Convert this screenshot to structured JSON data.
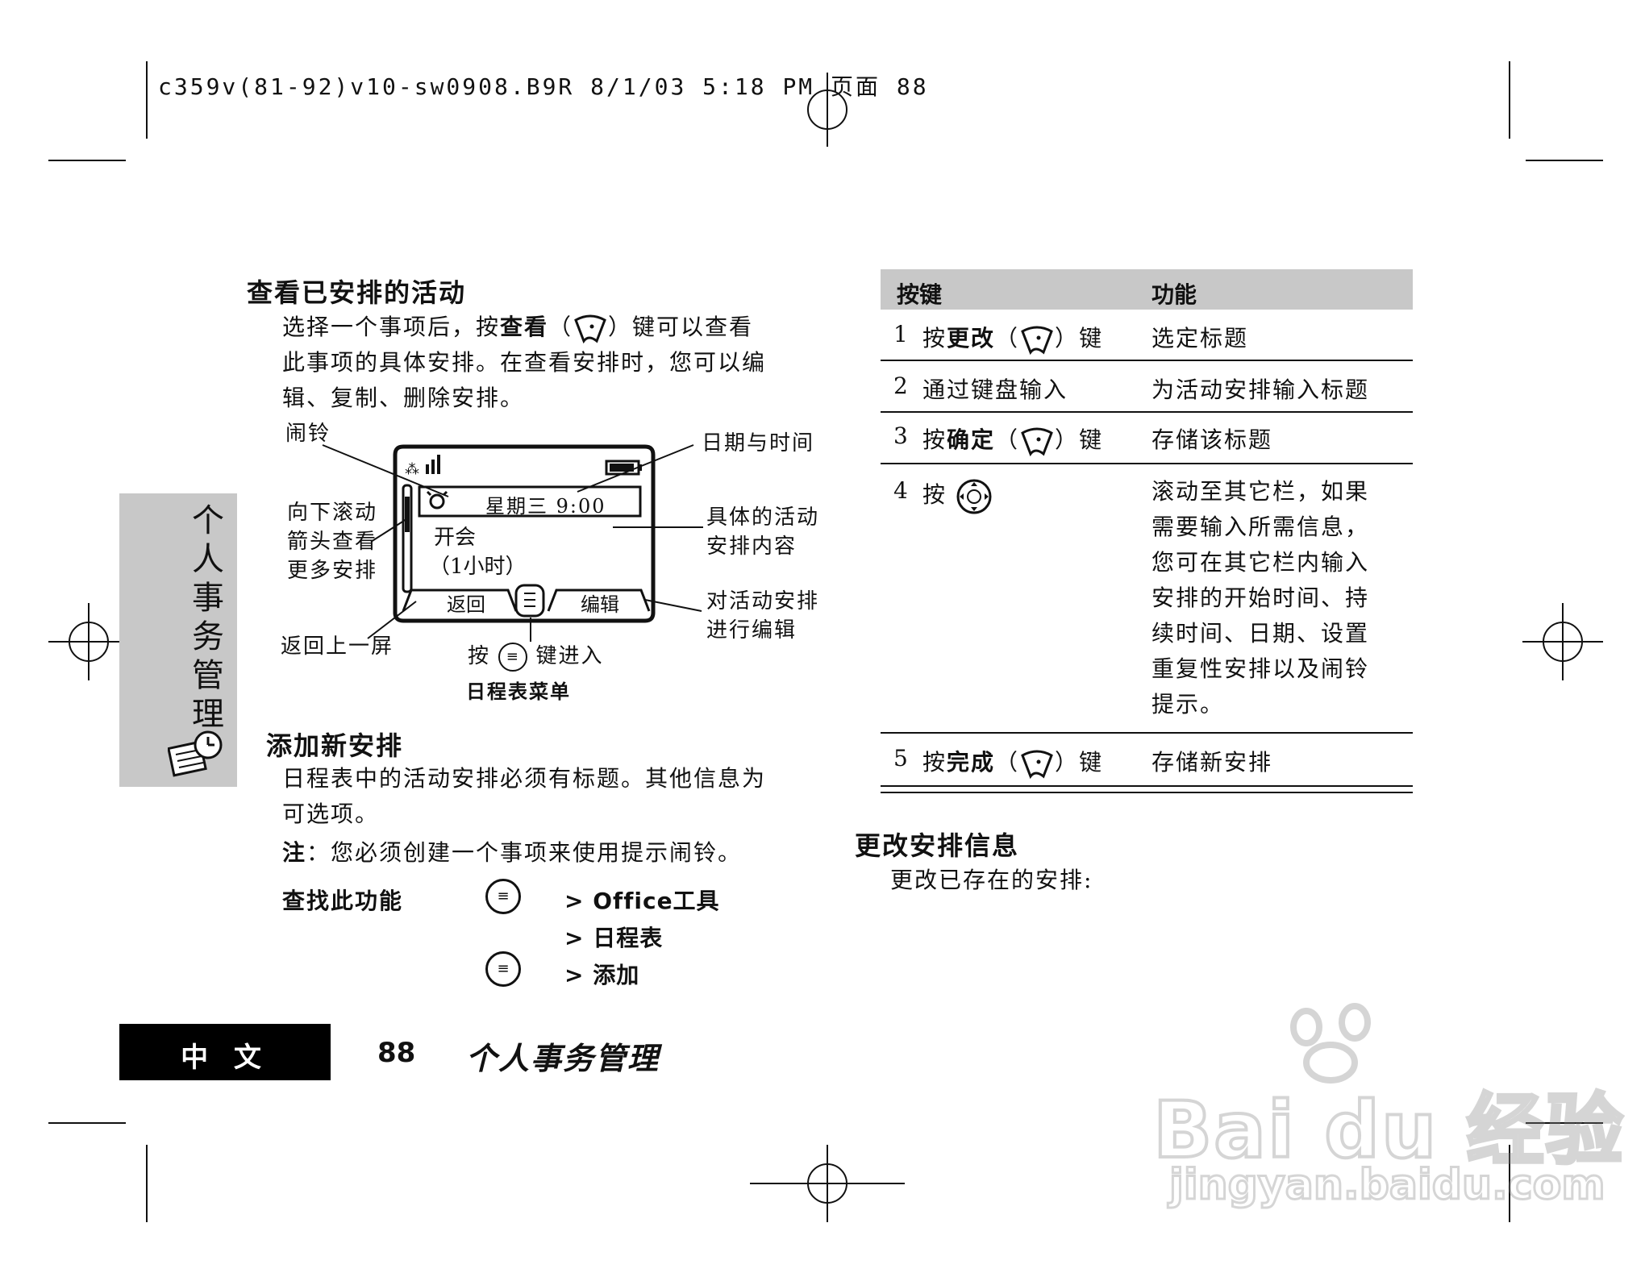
{
  "print_header": {
    "text": "c359v(81-92)v10-sw0908.B9R  8/1/03  5:18 PM  页面 88"
  },
  "left": {
    "section1": {
      "title": "查看已安排的活动",
      "para_line1_a": "选择一个事项后，按",
      "para_line1_bold": "查看",
      "para_line1_b": "）键可以查看",
      "para_line2": "此事项的具体安排。在查看安排时，您可以编",
      "para_line3": "辑、复制、删除安排。"
    },
    "diagram": {
      "screen_day_time": "星期三  9:00",
      "screen_content_line1": "开会",
      "screen_content_line2": "（1小时）",
      "softkey_left": "返回",
      "softkey_right": "编辑",
      "callout_alarm": "闹铃",
      "callout_datetime": "日期与时间",
      "callout_scroll_1": "向下滚动",
      "callout_scroll_2": "箭头查看",
      "callout_scroll_3": "更多安排",
      "callout_details_1": "具体的活动",
      "callout_details_2": "安排内容",
      "callout_edit_1": "对活动安排",
      "callout_edit_2": "进行编辑",
      "callout_back": "返回上一屏",
      "callout_press": "按",
      "callout_key_enter": "键进入",
      "callout_calendar_menu": "日程表菜单"
    },
    "section2": {
      "title": "添加新安排",
      "para_line1": "日程表中的活动安排必须有标题。其他信息为",
      "para_line2": "可选项。",
      "note_label": "注",
      "note_text": "：您必须创建一个事项来使用提示闹铃。",
      "find_label": "查找此功能",
      "path1": "> Office工具",
      "path2": "> 日程表",
      "path3": "> 添加"
    }
  },
  "side_tab": {
    "chars": [
      "个",
      "人",
      "事",
      "务",
      "管",
      "理"
    ],
    "icon": "calendar-clock-icon"
  },
  "table": {
    "headers": [
      "按键",
      "功能"
    ],
    "rows": [
      {
        "num": "1",
        "pre": "按",
        "bold": "更改",
        "post": "键",
        "func": "选定标题"
      },
      {
        "num": "2",
        "pre": "通过键盘输入",
        "bold": "",
        "post": "",
        "func": "为活动安排输入标题"
      },
      {
        "num": "3",
        "pre": "按",
        "bold": "确定",
        "post": "键",
        "func": "存储该标题"
      },
      {
        "num": "4",
        "pre": "按",
        "bold": "",
        "post": "",
        "func_lines": [
          "滚动至其它栏，如果",
          "需要输入所需信息，",
          "您可在其它栏内输入",
          "安排的开始时间、持",
          "续时间、日期、设置",
          "重复性安排以及闹铃",
          "提示。"
        ]
      },
      {
        "num": "5",
        "pre": "按",
        "bold": "完成",
        "post": "键",
        "func": "存储新安排"
      }
    ],
    "header_bg": "#c8c8c8"
  },
  "right": {
    "title": "更改安排信息",
    "text": "更改已存在的安排:"
  },
  "footer": {
    "lang": "中 文",
    "page": "88",
    "chapter": "个人事务管理"
  },
  "watermark": {
    "brand": "Bai du 经验",
    "url": "jingyan.baidu.com"
  }
}
